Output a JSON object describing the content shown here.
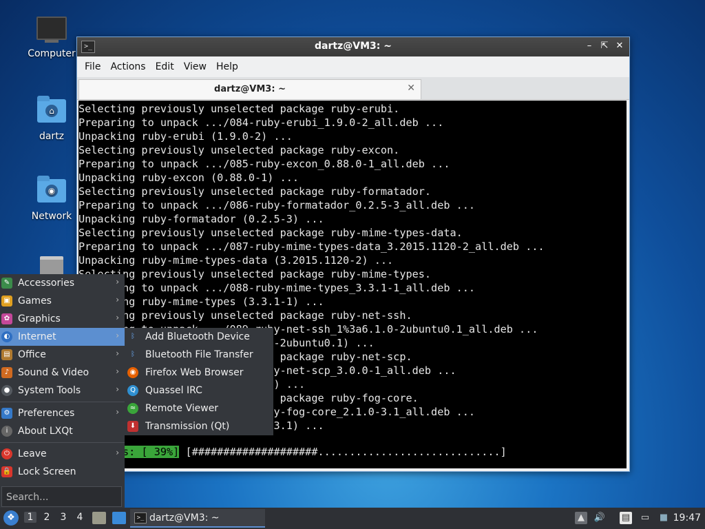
{
  "desktop": {
    "icons": [
      {
        "label": "Computer"
      },
      {
        "label": "dartz"
      },
      {
        "label": "Network"
      },
      {
        "label": ""
      }
    ]
  },
  "window": {
    "title": "dartz@VM3: ~",
    "menu": [
      "File",
      "Actions",
      "Edit",
      "View",
      "Help"
    ],
    "tab_label": "dartz@VM3: ~",
    "terminal_lines": [
      "Selecting previously unselected package ruby-erubi.",
      "Preparing to unpack .../084-ruby-erubi_1.9.0-2_all.deb ...",
      "Unpacking ruby-erubi (1.9.0-2) ...",
      "Selecting previously unselected package ruby-excon.",
      "Preparing to unpack .../085-ruby-excon_0.88.0-1_all.deb ...",
      "Unpacking ruby-excon (0.88.0-1) ...",
      "Selecting previously unselected package ruby-formatador.",
      "Preparing to unpack .../086-ruby-formatador_0.2.5-3_all.deb ...",
      "Unpacking ruby-formatador (0.2.5-3) ...",
      "Selecting previously unselected package ruby-mime-types-data.",
      "Preparing to unpack .../087-ruby-mime-types-data_3.2015.1120-2_all.deb ...",
      "Unpacking ruby-mime-types-data (3.2015.1120-2) ...",
      "Selecting previously unselected package ruby-mime-types.",
      "Preparing to unpack .../088-ruby-mime-types_3.3.1-1_all.deb ...",
      "Unpacking ruby-mime-types (3.3.1-1) ...",
      "Selecting previously unselected package ruby-net-ssh.",
      "Preparing to unpack .../089-ruby-net-ssh_1%3a6.1.0-2ubuntu0.1_all.deb ...",
      "Unpacking ruby-net-ssh (1:6.1.0-2ubuntu0.1) ...",
      "Selecting previously unselected package ruby-net-scp.",
      "Preparing to unpack .../090-ruby-net-scp_3.0.0-1_all.deb ...",
      "Unpacking ruby-net-scp (3.0.0-1) ...",
      "Selecting previously unselected package ruby-fog-core.",
      "Preparing to unpack .../091-ruby-fog-core_2.1.0-3.1_all.deb ...",
      "Unpacking ruby-fog-core (2.1.0-3.1) ..."
    ],
    "progress_label": "Progress: [ 39%]",
    "progress_bar": " [####################.............................]",
    "progress_percent": 39
  },
  "start_menu": {
    "items": [
      {
        "label": "Accessories",
        "icon": "accessories-icon",
        "arrow": "›"
      },
      {
        "label": "Games",
        "icon": "games-icon",
        "arrow": "›"
      },
      {
        "label": "Graphics",
        "icon": "graphics-icon",
        "arrow": "›"
      },
      {
        "label": "Internet",
        "icon": "internet-icon",
        "arrow": "›"
      },
      {
        "label": "Office",
        "icon": "office-icon",
        "arrow": "›"
      },
      {
        "label": "Sound & Video",
        "icon": "sound-video-icon",
        "arrow": "›"
      },
      {
        "label": "System Tools",
        "icon": "system-tools-icon",
        "arrow": "›"
      },
      {
        "label": "Preferences",
        "icon": "preferences-icon",
        "arrow": "›"
      },
      {
        "label": "About LXQt",
        "icon": "info-icon",
        "arrow": ""
      },
      {
        "label": "Leave",
        "icon": "power-icon",
        "arrow": "›"
      },
      {
        "label": "Lock Screen",
        "icon": "lock-icon",
        "arrow": ""
      }
    ],
    "search_placeholder": "Search..."
  },
  "internet_submenu": {
    "items": [
      {
        "label": "Add Bluetooth Device",
        "icon": "bluetooth-icon"
      },
      {
        "label": "Bluetooth File Transfer",
        "icon": "bluetooth-icon"
      },
      {
        "label": "Firefox Web Browser",
        "icon": "firefox-icon"
      },
      {
        "label": "Quassel IRC",
        "icon": "quassel-icon"
      },
      {
        "label": "Remote Viewer",
        "icon": "remote-viewer-icon"
      },
      {
        "label": "Transmission (Qt)",
        "icon": "transmission-icon"
      }
    ]
  },
  "taskbar": {
    "workspaces": [
      "1",
      "2",
      "3",
      "4"
    ],
    "task_label": "dartz@VM3: ~",
    "clock": "19:47"
  },
  "colors": {
    "menu_bg": "#34373c",
    "menu_highlight": "#5c8fd0",
    "progress_green": "#3aa53a",
    "taskbar_bg": "#2e3035"
  }
}
